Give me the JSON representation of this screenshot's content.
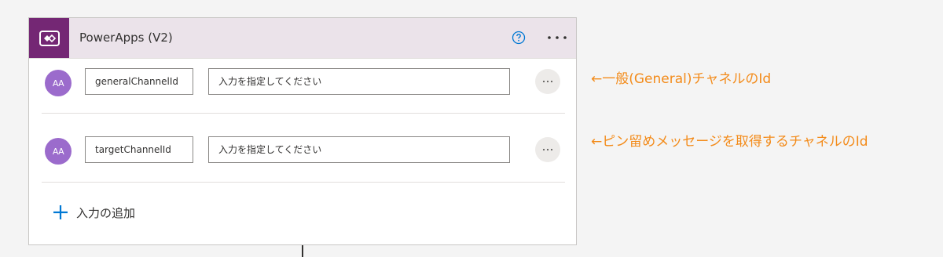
{
  "card": {
    "title": "PowerApps (V2)",
    "icons": {
      "app": "powerapps-icon",
      "help": "help-circle-icon",
      "menu": "more-horizontal-icon"
    }
  },
  "params": [
    {
      "avatar": "AA",
      "name": "generalChannelId",
      "placeholder": "入力を指定してください",
      "value": ""
    },
    {
      "avatar": "AA",
      "name": "targetChannelId",
      "placeholder": "入力を指定してください",
      "value": ""
    }
  ],
  "add_input": {
    "label": "入力の追加",
    "icon": "plus-icon"
  },
  "annotations": [
    "←一般(General)チャネルのId",
    "←ピン留めメッセージを取得するチャネルのId"
  ],
  "colors": {
    "header_bg": "#ebe3ea",
    "app_icon_bg": "#742774",
    "avatar_bg": "#9b6bcc",
    "accent": "#0078d4",
    "annotation": "#f38b1a"
  }
}
